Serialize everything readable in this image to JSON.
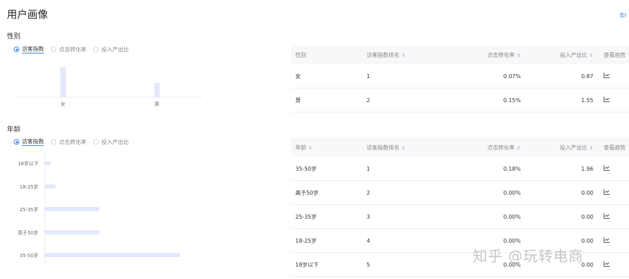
{
  "page": {
    "title": "用户画像",
    "top_link": "去Ⅰ"
  },
  "gender": {
    "title": "性别",
    "metrics": [
      "访客指数",
      "点击转化率",
      "投入产出比"
    ],
    "active_metric": 0,
    "chart_data": {
      "type": "bar",
      "categories": [
        "女",
        "男"
      ],
      "values": [
        44,
        21
      ]
    },
    "table": {
      "headers": [
        "性别",
        "访客指数排名",
        "点击转化率",
        "投入产出比",
        "查看趋势"
      ],
      "sortable": [
        false,
        true,
        true,
        true,
        false
      ],
      "rows": [
        {
          "name": "女",
          "rank": "1",
          "ctr": "0.07%",
          "roi": "0.87"
        },
        {
          "name": "男",
          "rank": "2",
          "ctr": "0.15%",
          "roi": "1.55"
        }
      ]
    }
  },
  "age": {
    "title": "年龄",
    "metrics": [
      "访客指数",
      "点击转化率",
      "投入产出比"
    ],
    "active_metric": 0,
    "chart_data": {
      "type": "bar",
      "orientation": "horizontal",
      "categories": [
        "18岁以下",
        "18-25岁",
        "25-35岁",
        "高于50岁",
        "35-50岁"
      ],
      "values": [
        9,
        16,
        80,
        80,
        198
      ]
    },
    "table": {
      "headers": [
        "年龄",
        "访客指数排名",
        "点击转化率",
        "投入产出比",
        "查看趋势"
      ],
      "sortable": [
        true,
        true,
        true,
        true,
        false
      ],
      "rows": [
        {
          "name": "35-50岁",
          "rank": "1",
          "ctr": "0.18%",
          "roi": "1.96"
        },
        {
          "name": "高于50岁",
          "rank": "2",
          "ctr": "0.00%",
          "roi": "0.00"
        },
        {
          "name": "25-35岁",
          "rank": "3",
          "ctr": "0.00%",
          "roi": "0.00"
        },
        {
          "name": "18-25岁",
          "rank": "4",
          "ctr": "0.00%",
          "roi": "0.00"
        },
        {
          "name": "18岁以下",
          "rank": "5",
          "ctr": "0.00%",
          "roi": "0.00"
        }
      ]
    }
  },
  "icons": {
    "sort": "⇕",
    "trend": "trend-chart-icon"
  },
  "colors": {
    "accent": "#3d7fe0",
    "bar": "#e3e8fb"
  },
  "watermark": "知乎 @玩转电商"
}
